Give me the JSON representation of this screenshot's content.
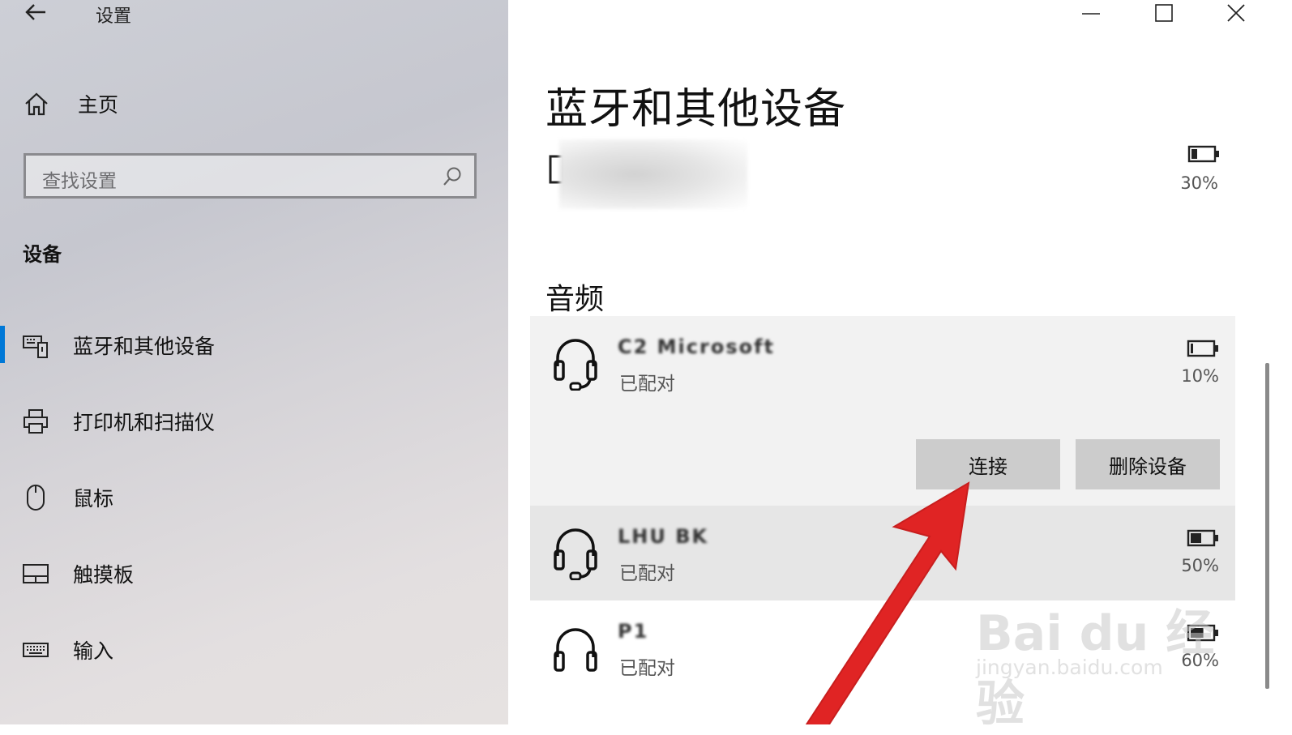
{
  "window": {
    "title": "设置"
  },
  "nav": {
    "home_label": "主页",
    "search_placeholder": "查找设置",
    "section_heading": "设备",
    "items": [
      {
        "label": "蓝牙和其他设备",
        "icon": "bluetooth-devices-icon",
        "active": true
      },
      {
        "label": "打印机和扫描仪",
        "icon": "printer-icon",
        "active": false
      },
      {
        "label": "鼠标",
        "icon": "mouse-icon",
        "active": false
      },
      {
        "label": "触摸板",
        "icon": "touchpad-icon",
        "active": false
      },
      {
        "label": "输入",
        "icon": "keyboard-icon",
        "active": false
      }
    ]
  },
  "main": {
    "page_title": "蓝牙和其他设备",
    "top_device": {
      "battery": "30%"
    },
    "audio_heading": "音频",
    "devices": [
      {
        "name": "C2 Microsoft",
        "status": "已配对",
        "battery": "10%",
        "battery_level": 0.1,
        "expanded": true,
        "buttons": {
          "connect": "连接",
          "remove": "删除设备"
        }
      },
      {
        "name": "LHU BK",
        "status": "已配对",
        "battery": "50%",
        "battery_level": 0.5,
        "expanded": false
      },
      {
        "name": "P1",
        "status": "已配对",
        "battery": "60%",
        "battery_level": 0.6,
        "expanded": false
      }
    ]
  },
  "watermark": {
    "line1": "Bai du 经验",
    "line2": "jingyan.baidu.com"
  },
  "colors": {
    "accent": "#0078d7",
    "arrow": "#e02424",
    "button_bg": "#cccccc"
  }
}
